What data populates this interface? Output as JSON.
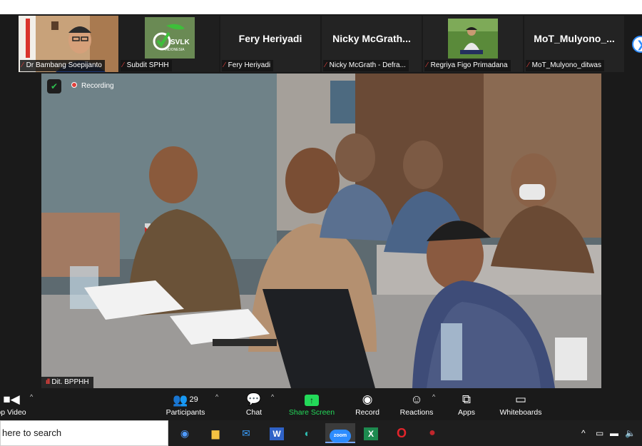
{
  "gallery": {
    "tiles": [
      {
        "label": "Dr Bambang Soepijanto",
        "name_text": "",
        "type": "video"
      },
      {
        "label": "Subdit SPHH",
        "name_text": "",
        "type": "logo",
        "logo_text": "SVLK",
        "logo_sub": "INDONESIA"
      },
      {
        "label": "Fery Heriyadi",
        "name_text": "Fery Heriyadi",
        "type": "name"
      },
      {
        "label": "Nicky McGrath - Defra...",
        "name_text": "Nicky  McGrath...",
        "type": "name"
      },
      {
        "label": "Regriya Figo Primadana",
        "name_text": "",
        "type": "video"
      },
      {
        "label": "MoT_Mulyono_ditwas",
        "name_text": "MoT_Mulyono_...",
        "type": "name"
      }
    ],
    "next_icon": "chevron-right-icon"
  },
  "main_video": {
    "recording_label": "Recording",
    "speaker_label": "Dit. BPPHH"
  },
  "toolbar": {
    "buttons": [
      {
        "id": "video",
        "label": "op Video",
        "icon": "video-camera-icon"
      },
      {
        "id": "participants",
        "label": "Participants",
        "icon": "participants-icon",
        "count": "29"
      },
      {
        "id": "chat",
        "label": "Chat",
        "icon": "chat-icon"
      },
      {
        "id": "share",
        "label": "Share Screen",
        "icon": "share-screen-icon"
      },
      {
        "id": "record",
        "label": "Record",
        "icon": "record-icon"
      },
      {
        "id": "reactions",
        "label": "Reactions",
        "icon": "reactions-icon"
      },
      {
        "id": "apps",
        "label": "Apps",
        "icon": "apps-icon"
      },
      {
        "id": "whiteboards",
        "label": "Whiteboards",
        "icon": "whiteboard-icon"
      }
    ],
    "share_color": "#23d959"
  },
  "taskbar": {
    "search_text": "here to search",
    "apps": [
      {
        "name": "browser-icon",
        "glyph": "◉",
        "color": "#4f9bff"
      },
      {
        "name": "file-explorer-icon",
        "glyph": "▆",
        "color": "#f5c242"
      },
      {
        "name": "mail-icon",
        "glyph": "✉",
        "color": "#3aa0ff"
      },
      {
        "name": "word-icon",
        "glyph": "W",
        "color": "#2f62c7"
      },
      {
        "name": "edge-icon",
        "glyph": "◐",
        "color": "#2fc1b5"
      },
      {
        "name": "zoom-icon",
        "glyph": "zoom",
        "color": "#2d8cff"
      },
      {
        "name": "excel-icon",
        "glyph": "X",
        "color": "#1d8a4f"
      },
      {
        "name": "opera-icon",
        "glyph": "O",
        "color": "#e3242b"
      },
      {
        "name": "app-badge-icon",
        "glyph": "●",
        "color": "#c0262c"
      }
    ]
  }
}
